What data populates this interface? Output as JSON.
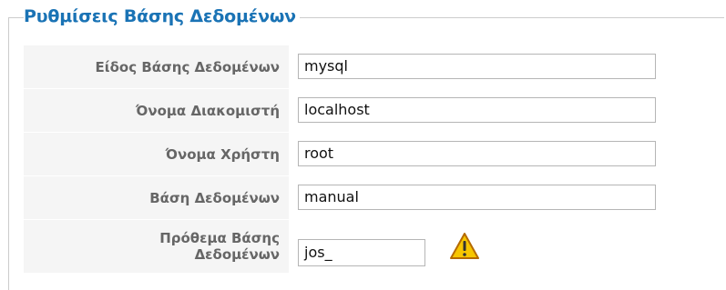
{
  "section": {
    "title": "Ρυθμίσεις Βάσης Δεδομένων"
  },
  "fields": [
    {
      "label": "Είδος Βάσης Δεδομένων",
      "value": "mysql"
    },
    {
      "label": "Όνομα Διακομιστή",
      "value": "localhost"
    },
    {
      "label": "Όνομα Χρήστη",
      "value": "root"
    },
    {
      "label": "Βάση Δεδομένων",
      "value": "manual"
    },
    {
      "label": "Πρόθεμα Βάσης Δεδομένων",
      "value": "jos_"
    }
  ],
  "warning": {
    "icon": "warning-icon",
    "color": "#f2c200"
  },
  "colors": {
    "legend": "#1a73b5",
    "label_bg": "#f5f5f5",
    "label_text": "#666666",
    "border": "#cccccc"
  }
}
